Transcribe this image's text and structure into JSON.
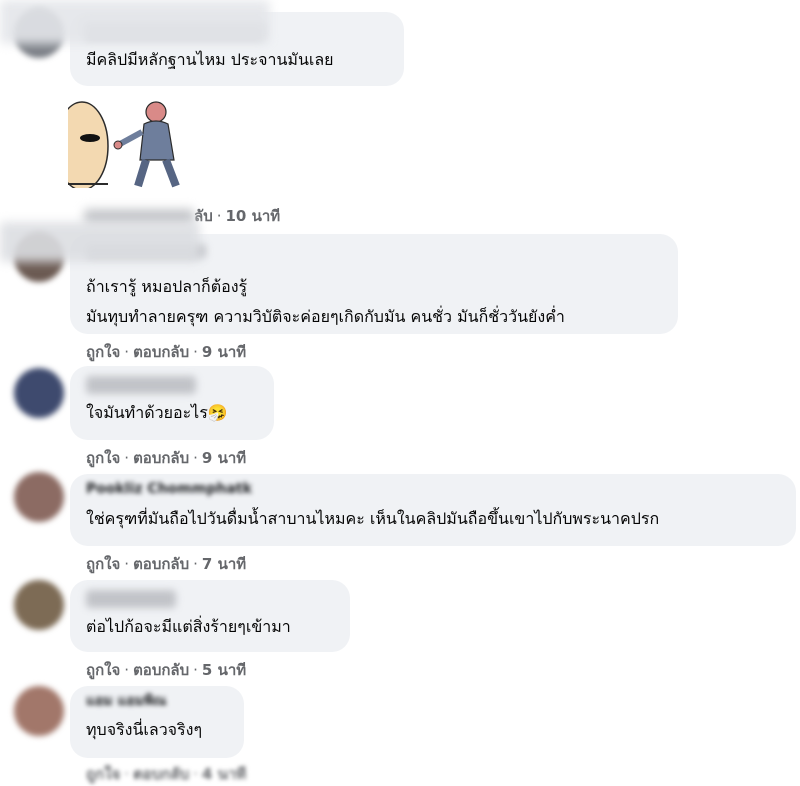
{
  "comments": [
    {
      "text_lines": [
        "มีคลิปมีหลักฐานไหม ประจานมันเลย"
      ],
      "meta": {
        "like": "",
        "reply": "ตอบกลับ",
        "time": "10 นาที",
        "partial": "ลับ"
      },
      "avatar_color": "#7b7f86"
    },
    {
      "text_lines": [
        "ถ้าเรารู้ หมอปลาก็ต้องรู้",
        "มันทุบทำลายครุฑ ความวิบัติจะค่อยๆเกิดกับมัน คนชั่ว มันก็ชั่ววันยังค่ำ"
      ],
      "meta": {
        "like": "ถูกใจ",
        "reply": "ตอบกลับ",
        "time": "9 นาที"
      },
      "avatar_color": "#6b5a52"
    },
    {
      "text_lines": [
        "ใจมันทำด้วยอะไร🤧"
      ],
      "meta": {
        "like": "ถูกใจ",
        "reply": "ตอบกลับ",
        "time": "9 นาที"
      },
      "avatar_color": "#3e4a6e"
    },
    {
      "author": "Pookliz Chommphatk",
      "text_lines": [
        "ใช่ครุฑที่มันถือไปวันดื่มน้ำสาบานไหมคะ เห็นในคลิปมันถือขึ้นเขาไปกับพระนาคปรก"
      ],
      "meta": {
        "like": "ถูกใจ",
        "reply": "ตอบกลับ",
        "time": "7 นาที"
      },
      "avatar_color": "#8c6b63"
    },
    {
      "text_lines": [
        "ต่อไปก้อจะมีแต่สิ่งร้ายๆเข้ามา"
      ],
      "meta": {
        "like": "ถูกใจ",
        "reply": "ตอบกลับ",
        "time": "5 นาที"
      },
      "avatar_color": "#7d6b55"
    },
    {
      "author": "แอม แอมพิณ",
      "text_lines": [
        "ทุบจริงนี่เลวจริงๆ"
      ],
      "meta": {
        "like": "ถูกใจ",
        "reply": "ตอบกลับ",
        "time": "4 นาที"
      },
      "avatar_color": "#a2776a"
    }
  ],
  "colors": {
    "bubble": "#f0f2f5",
    "meta": "#65676b",
    "text": "#050505"
  }
}
